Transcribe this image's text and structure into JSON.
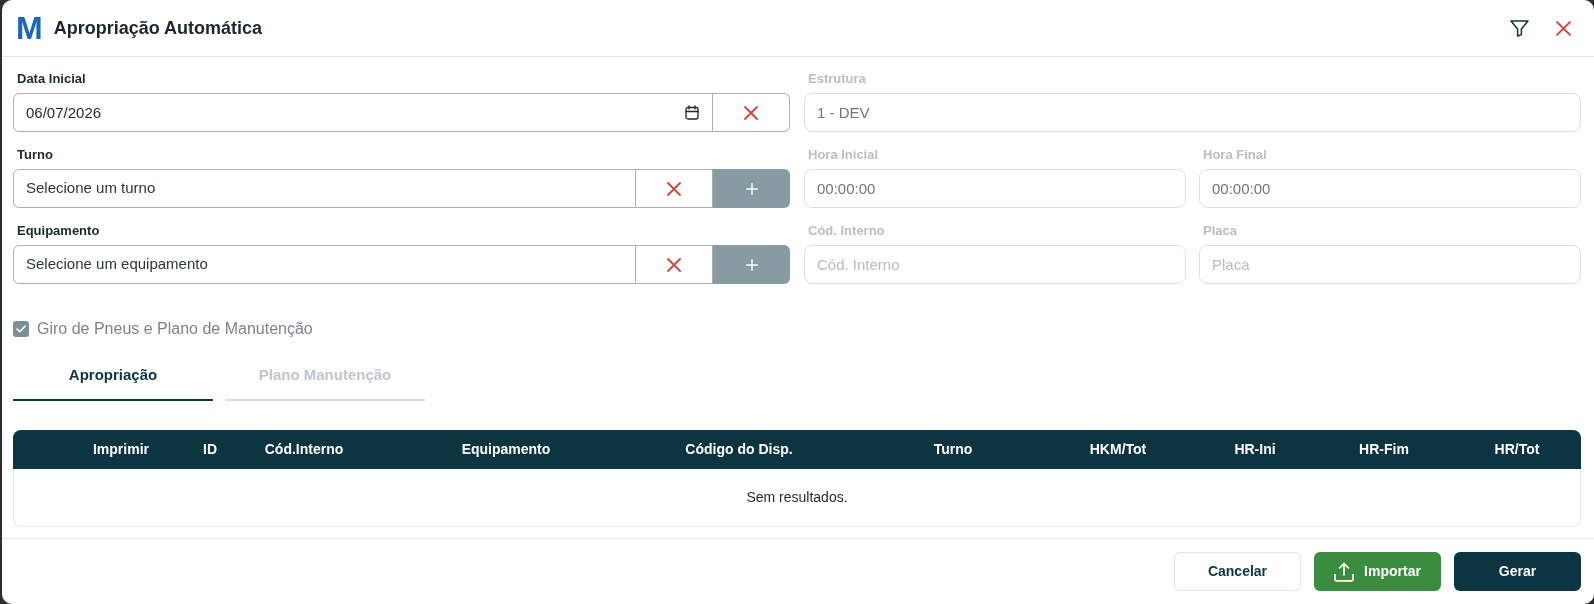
{
  "window": {
    "logo": "M",
    "title": "Apropriação Automática"
  },
  "form": {
    "rows": [
      {
        "fields": [
          {
            "kind": "date",
            "label": "Data Inicial",
            "value": "06/07/2026",
            "disabled": false
          },
          {
            "kind": "text",
            "label": "Estrutura",
            "value": "1 - DEV",
            "disabled": true
          }
        ]
      },
      {
        "fields": [
          {
            "kind": "select",
            "label": "Turno",
            "placeholder": "Selecione um turno",
            "disabled": false
          },
          {
            "kind": "text",
            "label": "Hora Inicial",
            "value": "00:00:00",
            "disabled": true
          },
          {
            "kind": "text",
            "label": "Hora Final",
            "value": "00:00:00",
            "disabled": true
          }
        ]
      },
      {
        "fields": [
          {
            "kind": "select",
            "label": "Equipamento",
            "placeholder": "Selecione um equipamento",
            "disabled": false
          },
          {
            "kind": "text",
            "label": "Cód. Interno",
            "placeholder": "Cód. Interno",
            "disabled": true
          },
          {
            "kind": "text",
            "label": "Placa",
            "placeholder": "Placa",
            "disabled": true
          }
        ]
      }
    ]
  },
  "option": {
    "label": "Giro de Pneus e Plano de Manutenção",
    "checked": true,
    "disabled": true
  },
  "tabs": [
    {
      "label": "Apropriação",
      "selected": true
    },
    {
      "label": "Plano Manutenção",
      "selected": false
    }
  ],
  "table": {
    "columns": [
      "Imprimir",
      "ID",
      "Cód.Interno",
      "Equipamento",
      "Código do Disp.",
      "Turno",
      "HKM/Tot",
      "HR-Ini",
      "HR-Fim",
      "HR/Tot"
    ],
    "empty_message": "Sem resultados."
  },
  "buttons": [
    {
      "kind": "secondary",
      "label": "Cancelar"
    },
    {
      "kind": "import",
      "label": "Importar"
    },
    {
      "kind": "primary",
      "label": "Gerar"
    }
  ]
}
